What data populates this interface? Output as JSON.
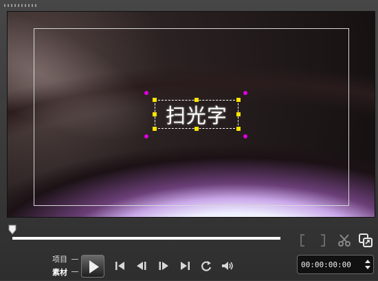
{
  "preview": {
    "title_text": "扫光字"
  },
  "player": {
    "mode_project": "项目",
    "mode_clip": "素材",
    "timecode": "00:00:00:00",
    "playhead_fraction": 0.0
  },
  "icons": {
    "mark_in": "mark-in-icon",
    "mark_out": "mark-out-icon",
    "cut": "scissors-icon",
    "enlarge": "enlarge-preview-icon",
    "play": "play-icon",
    "home": "go-start-icon",
    "prev": "previous-frame-icon",
    "next": "next-frame-icon",
    "end": "go-end-icon",
    "repeat": "repeat-icon",
    "volume": "volume-icon"
  },
  "colors": {
    "handle": "#ffe400",
    "rotate_handle": "#e000e0"
  }
}
